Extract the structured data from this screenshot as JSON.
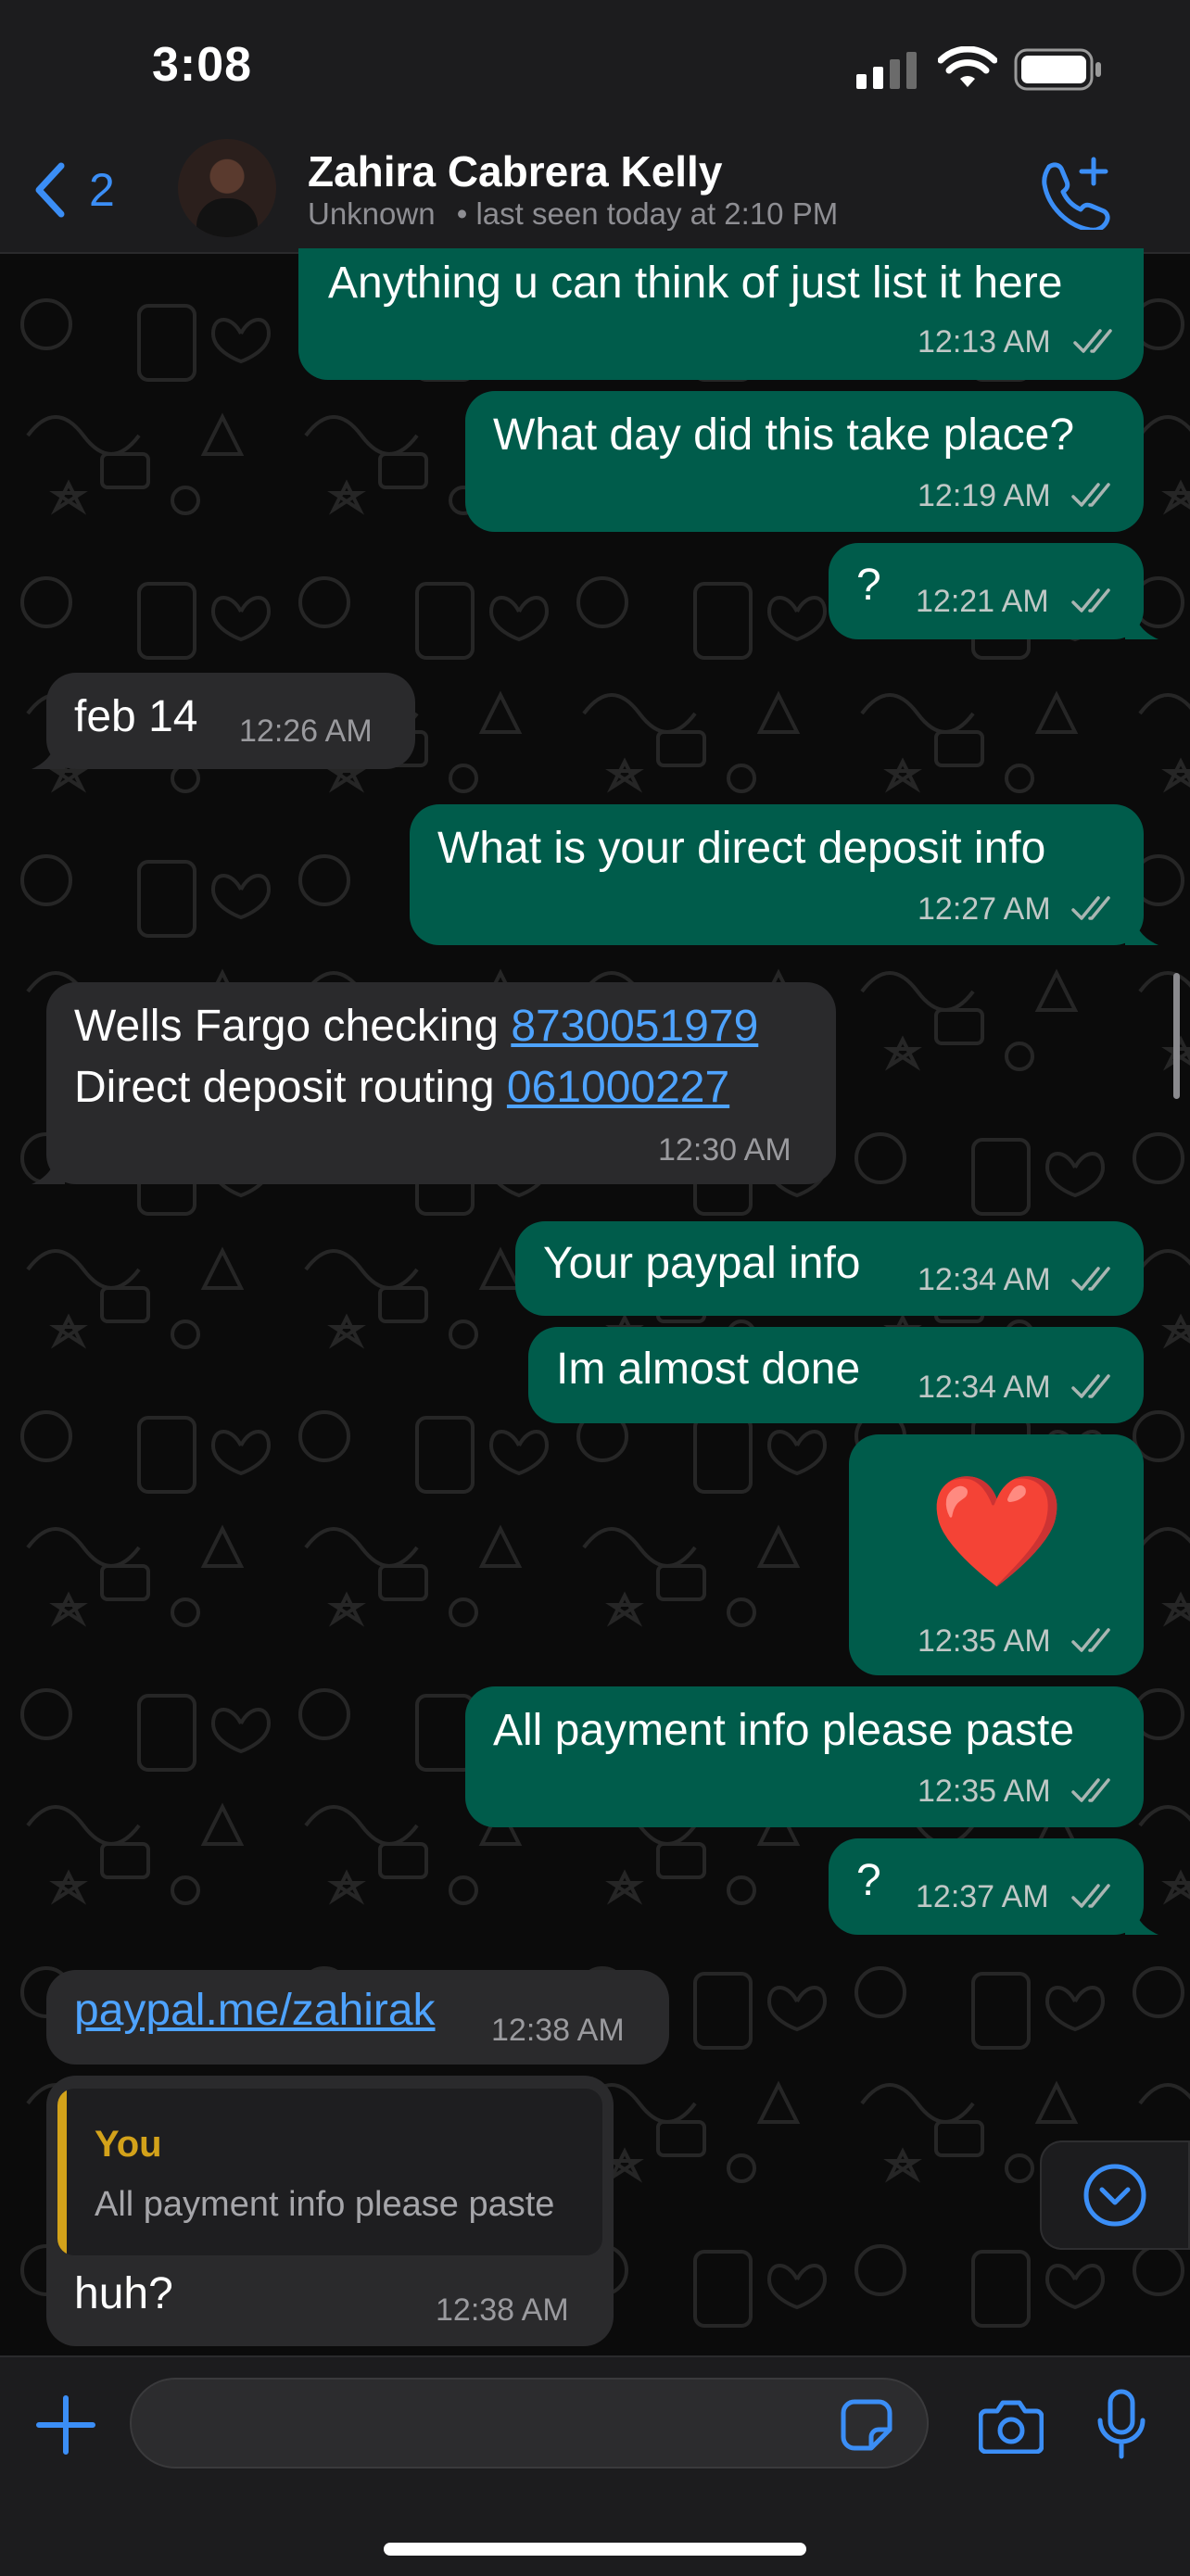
{
  "status_bar": {
    "time": "3:08"
  },
  "header": {
    "back_count": "2",
    "contact_name": "Zahira Cabrera Kelly",
    "contact_status_1": "Unknown",
    "contact_status_2": "• last seen today at 2:10 PM"
  },
  "messages": [
    {
      "dir": "out",
      "text": "Anything u can think of just list it here",
      "time": "12:13 AM"
    },
    {
      "dir": "out",
      "text": "What day did this take place?",
      "time": "12:19 AM"
    },
    {
      "dir": "out",
      "text": "?",
      "time": "12:21 AM"
    },
    {
      "dir": "in",
      "text": "feb 14",
      "time": "12:26 AM"
    },
    {
      "dir": "out",
      "text": "What is your direct deposit info",
      "time": "12:27 AM"
    },
    {
      "dir": "in",
      "line1_text": "Wells Fargo checking ",
      "line1_link": "8730051979",
      "line2_text": "Direct deposit routing ",
      "line2_link": "061000227",
      "time": "12:30 AM"
    },
    {
      "dir": "out",
      "text": "Your paypal info",
      "time": "12:34 AM"
    },
    {
      "dir": "out",
      "text": "Im almost done",
      "time": "12:34 AM"
    },
    {
      "dir": "out",
      "emoji": "❤️",
      "time": "12:35 AM"
    },
    {
      "dir": "out",
      "text": "All payment info please paste",
      "time": "12:35 AM"
    },
    {
      "dir": "out",
      "text": "?",
      "time": "12:37 AM"
    },
    {
      "dir": "in",
      "link": "paypal.me/zahirak",
      "time": "12:38 AM"
    },
    {
      "dir": "in",
      "quote_author": "You",
      "quote_text": "All payment info please paste",
      "text": "huh?",
      "time": "12:38 AM"
    }
  ],
  "composer": {
    "placeholder": ""
  },
  "icons": {
    "back": "chevron-left-icon",
    "call": "add-call-icon",
    "plus": "plus-icon",
    "sticker": "sticker-icon",
    "camera": "camera-icon",
    "mic": "microphone-icon",
    "scroll": "chevron-down-circle-icon",
    "read": "double-check-icon"
  },
  "colors": {
    "outgoing_bubble": "#005c4b",
    "incoming_bubble": "#2a2a2c",
    "accent": "#3b8ef6",
    "quote_accent": "#d3a21a",
    "link": "#4ea3ff"
  }
}
